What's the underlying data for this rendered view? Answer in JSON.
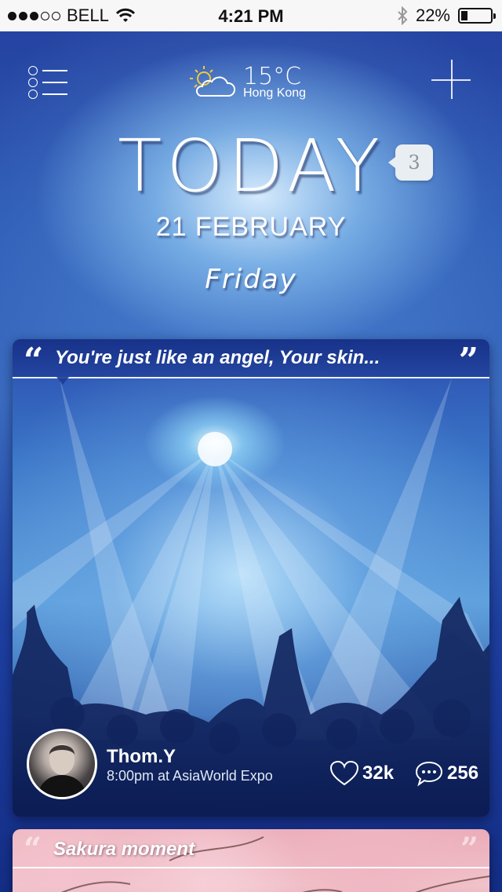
{
  "status_bar": {
    "carrier": "BELL",
    "time": "4:21 PM",
    "battery": "22%",
    "battery_level": 0.22,
    "signal_bars_filled": 3,
    "signal_bars_total": 5
  },
  "header": {
    "menu_icon": "list-menu-icon",
    "weather_icon": "partly-cloudy-icon",
    "temperature": "15°C",
    "city": "Hong Kong",
    "add_icon": "plus-icon"
  },
  "day": {
    "title": "TODAY",
    "badge_count": "3",
    "date": "21 FEBRUARY",
    "weekday": "Friday"
  },
  "posts": [
    {
      "quote": "You're just like an angel, Your skin...",
      "user": "Thom.Y",
      "event": "8:00pm at AsiaWorld Expo",
      "likes": "32k",
      "comments": "256",
      "accent": "#2a56b8"
    },
    {
      "quote": "Sakura moment",
      "accent": "#f0c0ca"
    }
  ],
  "colors": {
    "background_top": "#243f9e",
    "background_bottom": "#142e86",
    "status_bar_bg": "#f7f7f7",
    "badge_bg": "#e9eef2",
    "text": "#ffffff"
  }
}
